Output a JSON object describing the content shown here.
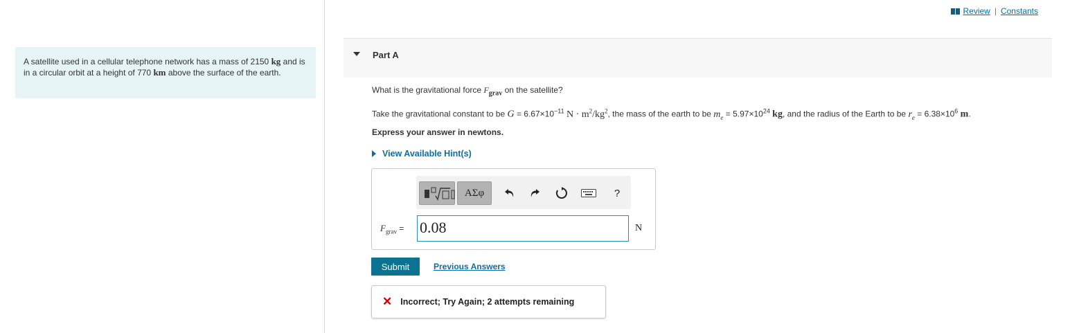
{
  "problem": {
    "text_a": "A satellite used in a cellular telephone network has a mass of 2150",
    "unit_a": "kg",
    "text_b": "and is in a circular orbit at a height of 770",
    "unit_b": "km",
    "text_c": "above the surface of the earth."
  },
  "top_links": {
    "review": "Review",
    "separator": "|",
    "constants": "Constants"
  },
  "part": {
    "label": "Part A",
    "question_pre": "What is the gravitational force",
    "question_symbol": "F",
    "question_sub": "grav",
    "question_post": "on the satellite?",
    "given": {
      "intro": "Take the gravitational constant to be",
      "G_sym": "G",
      "G_val": "= 6.67×10",
      "G_exp": "−11",
      "G_unit": "N · m",
      "G_unit_exp": "2",
      "G_unit_mid": "/kg",
      "G_unit_exp2": "2",
      "mid1": ", the mass of the earth to be",
      "me_sym": "m",
      "me_sub": "e",
      "me_val": "= 5.97×10",
      "me_exp": "24",
      "me_unit": "kg",
      "mid2": ", and the radius of the Earth to be",
      "re_sym": "r",
      "re_sub": "e",
      "re_val": "= 6.38×10",
      "re_exp": "6",
      "re_unit": "m",
      "end": "."
    },
    "express": "Express your answer in newtons.",
    "hints": "View Available Hint(s)"
  },
  "toolbar": {
    "symbols_label": "ΑΣφ",
    "undo_icon": "undo-icon",
    "redo_icon": "redo-icon",
    "reset_icon": "reset-icon",
    "keyboard_icon": "keyboard-icon",
    "help_label": "?"
  },
  "answer": {
    "label_symbol": "F",
    "label_sub": "grav",
    "label_eq": "=",
    "value": "0.08",
    "unit": "N"
  },
  "actions": {
    "submit": "Submit",
    "previous_answers": "Previous Answers"
  },
  "feedback": {
    "icon": "✕",
    "message": "Incorrect; Try Again; 2 attempts remaining"
  },
  "colors": {
    "accent": "#0b7391",
    "link": "#0b6fa4",
    "error": "#d40000",
    "problem_bg": "#e6f4f5"
  }
}
